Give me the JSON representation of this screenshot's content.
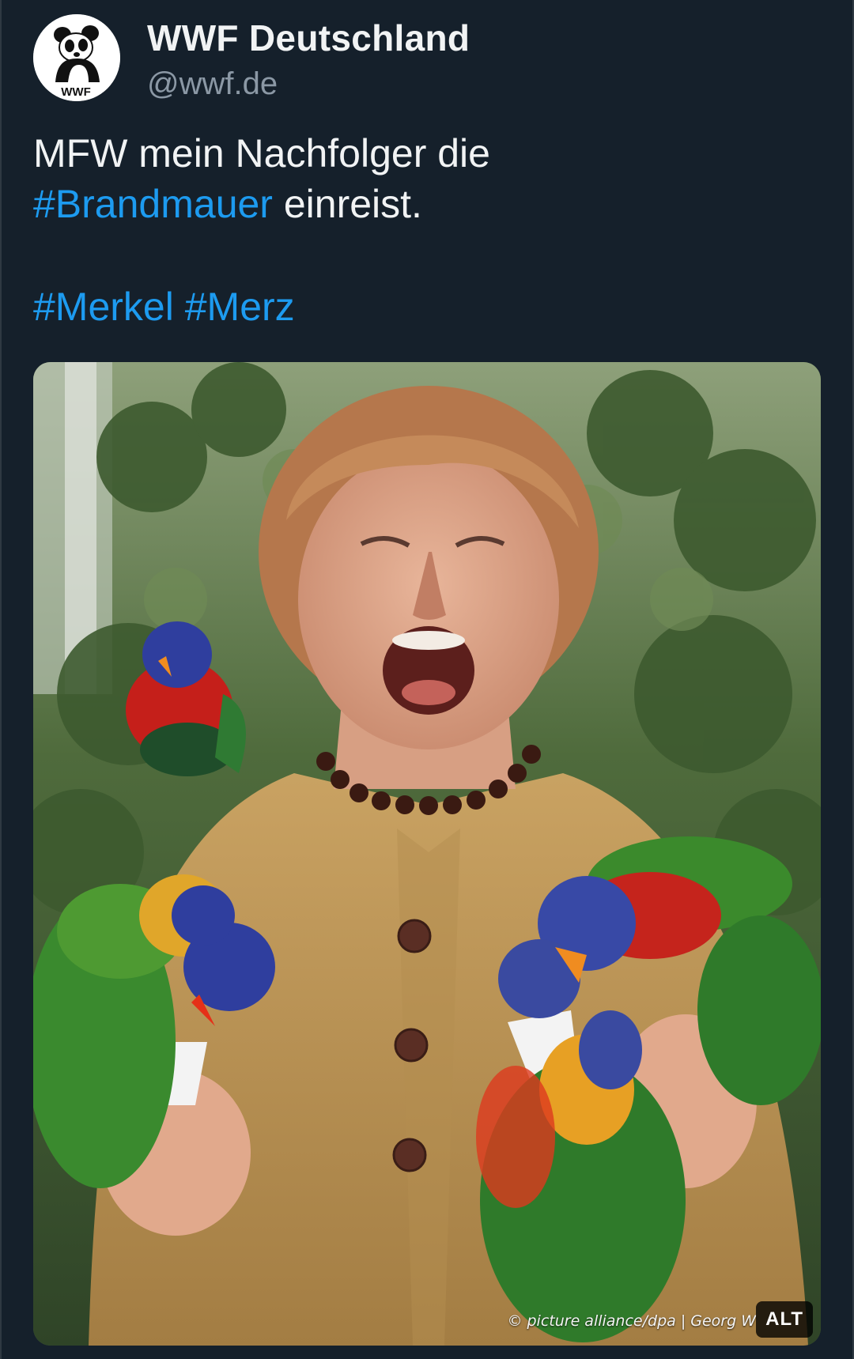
{
  "author": {
    "display_name": "WWF Deutschland",
    "handle": "@wwf.de",
    "avatar_logo_text": "WWF"
  },
  "tweet": {
    "line1": "MFW mein Nachfolger die",
    "hashtag_brandmauer": "#Brandmauer",
    "line2_rest": " einreist.",
    "hashtag_merkel": "#Merkel",
    "hashtag_merz": "#Merz"
  },
  "media": {
    "credit": "© picture alliance/dpa | Georg W",
    "alt_label": "ALT"
  },
  "colors": {
    "background": "#15202b",
    "hashtag": "#1d9bf0",
    "handle": "#8b98a5"
  }
}
